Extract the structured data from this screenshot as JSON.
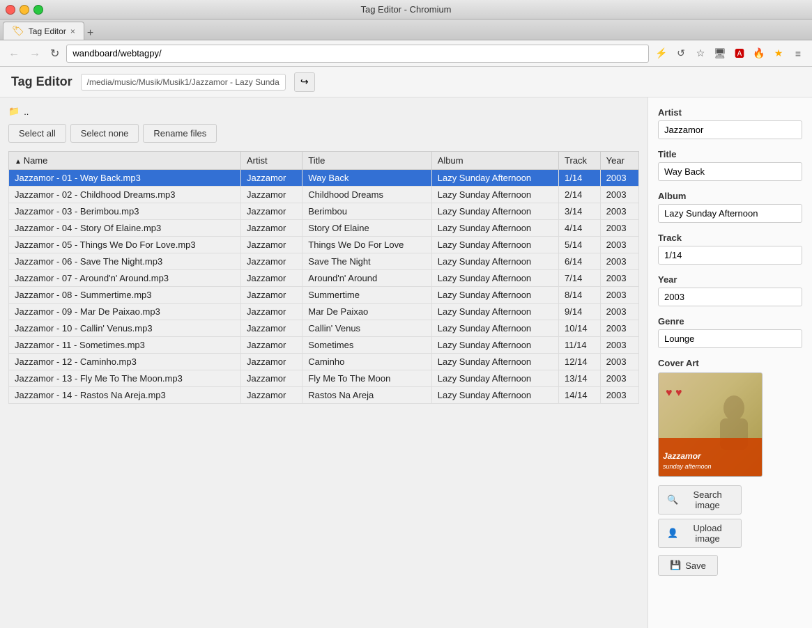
{
  "window": {
    "title": "Tag Editor - Chromium",
    "close_btn": "×",
    "min_btn": "–",
    "max_btn": "□"
  },
  "tab": {
    "label": "Tag Editor",
    "icon": "🏷"
  },
  "address_bar": {
    "url": "wandboard/webtagpy/",
    "back_btn": "←",
    "forward_btn": "→",
    "reload_btn": "↻"
  },
  "app": {
    "title": "Tag Editor",
    "path": "/media/music/Musik/Musik1/Jazzamor - Lazy Sunda",
    "share_icon": "↪"
  },
  "toolbar": {
    "select_all": "Select all",
    "select_none": "Select none",
    "rename_files": "Rename files"
  },
  "table": {
    "columns": [
      "Name",
      "Artist",
      "Title",
      "Album",
      "Track",
      "Year"
    ],
    "rows": [
      {
        "name": "Jazzamor - 01 - Way Back.mp3",
        "artist": "Jazzamor",
        "title": "Way Back",
        "album": "Lazy Sunday Afternoon",
        "track": "1/14",
        "year": "2003",
        "selected": true
      },
      {
        "name": "Jazzamor - 02 - Childhood Dreams.mp3",
        "artist": "Jazzamor",
        "title": "Childhood Dreams",
        "album": "Lazy Sunday Afternoon",
        "track": "2/14",
        "year": "2003",
        "selected": false
      },
      {
        "name": "Jazzamor - 03 - Berimbou.mp3",
        "artist": "Jazzamor",
        "title": "Berimbou",
        "album": "Lazy Sunday Afternoon",
        "track": "3/14",
        "year": "2003",
        "selected": false
      },
      {
        "name": "Jazzamor - 04 - Story Of Elaine.mp3",
        "artist": "Jazzamor",
        "title": "Story Of Elaine",
        "album": "Lazy Sunday Afternoon",
        "track": "4/14",
        "year": "2003",
        "selected": false
      },
      {
        "name": "Jazzamor - 05 - Things We Do For Love.mp3",
        "artist": "Jazzamor",
        "title": "Things We Do For Love",
        "album": "Lazy Sunday Afternoon",
        "track": "5/14",
        "year": "2003",
        "selected": false
      },
      {
        "name": "Jazzamor - 06 - Save The Night.mp3",
        "artist": "Jazzamor",
        "title": "Save The Night",
        "album": "Lazy Sunday Afternoon",
        "track": "6/14",
        "year": "2003",
        "selected": false
      },
      {
        "name": "Jazzamor - 07 - Around'n' Around.mp3",
        "artist": "Jazzamor",
        "title": "Around'n' Around",
        "album": "Lazy Sunday Afternoon",
        "track": "7/14",
        "year": "2003",
        "selected": false
      },
      {
        "name": "Jazzamor - 08 - Summertime.mp3",
        "artist": "Jazzamor",
        "title": "Summertime",
        "album": "Lazy Sunday Afternoon",
        "track": "8/14",
        "year": "2003",
        "selected": false
      },
      {
        "name": "Jazzamor - 09 - Mar De Paixao.mp3",
        "artist": "Jazzamor",
        "title": "Mar De Paixao",
        "album": "Lazy Sunday Afternoon",
        "track": "9/14",
        "year": "2003",
        "selected": false
      },
      {
        "name": "Jazzamor - 10 - Callin' Venus.mp3",
        "artist": "Jazzamor",
        "title": "Callin' Venus",
        "album": "Lazy Sunday Afternoon",
        "track": "10/14",
        "year": "2003",
        "selected": false
      },
      {
        "name": "Jazzamor - 11 - Sometimes.mp3",
        "artist": "Jazzamor",
        "title": "Sometimes",
        "album": "Lazy Sunday Afternoon",
        "track": "11/14",
        "year": "2003",
        "selected": false
      },
      {
        "name": "Jazzamor - 12 - Caminho.mp3",
        "artist": "Jazzamor",
        "title": "Caminho",
        "album": "Lazy Sunday Afternoon",
        "track": "12/14",
        "year": "2003",
        "selected": false
      },
      {
        "name": "Jazzamor - 13 - Fly Me To The Moon.mp3",
        "artist": "Jazzamor",
        "title": "Fly Me To The Moon",
        "album": "Lazy Sunday Afternoon",
        "track": "13/14",
        "year": "2003",
        "selected": false
      },
      {
        "name": "Jazzamor - 14 - Rastos Na Areja.mp3",
        "artist": "Jazzamor",
        "title": "Rastos Na Areja",
        "album": "Lazy Sunday Afternoon",
        "track": "14/14",
        "year": "2003",
        "selected": false
      }
    ]
  },
  "sidebar": {
    "artist_label": "Artist",
    "artist_value": "Jazzamor",
    "title_label": "Title",
    "title_value": "Way Back",
    "album_label": "Album",
    "album_value": "Lazy Sunday Afternoon",
    "track_label": "Track",
    "track_value": "1/14",
    "year_label": "Year",
    "year_value": "2003",
    "genre_label": "Genre",
    "genre_value": "Lounge",
    "cover_art_label": "Cover Art",
    "search_image_label": "Search image",
    "upload_image_label": "Upload image",
    "save_label": "Save"
  },
  "file_nav": {
    "folder_icon": "📁",
    "parent": ".."
  }
}
